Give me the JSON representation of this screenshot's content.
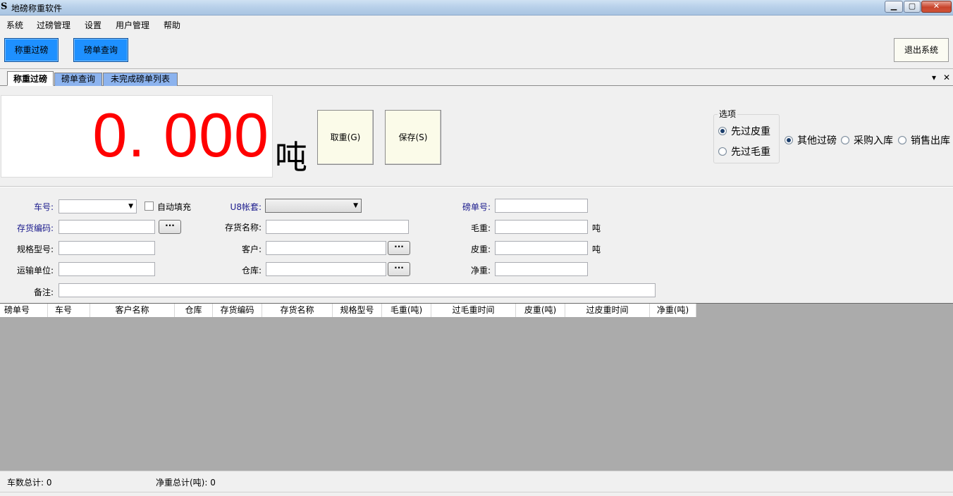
{
  "window": {
    "title": "地磅称重软件",
    "icon": "S"
  },
  "menu": [
    "系统",
    "过磅管理",
    "设置",
    "用户管理",
    "帮助"
  ],
  "toolbar": {
    "weigh_btn": "称重过磅",
    "query_btn": "磅单查询",
    "exit_btn": "退出系统"
  },
  "tabs": [
    {
      "label": "称重过磅",
      "active": true
    },
    {
      "label": "磅单查询",
      "active": false
    },
    {
      "label": "未完成磅单列表",
      "active": false
    }
  ],
  "tab_controls": {
    "dropdown": "▾",
    "close": "✕"
  },
  "scale": {
    "reading": "0. 000",
    "unit": "吨",
    "reading_color": "#ff0000"
  },
  "actions": {
    "take_weight": "取重(G)",
    "save": "保存(S)"
  },
  "options": {
    "group_title": "选项",
    "order": [
      {
        "label": "先过皮重",
        "checked": true
      },
      {
        "label": "先过毛重",
        "checked": false
      }
    ],
    "types": [
      {
        "label": "其他过磅",
        "checked": true
      },
      {
        "label": "采购入库",
        "checked": false
      },
      {
        "label": "销售出库",
        "checked": false
      }
    ]
  },
  "form": {
    "plate_label": "车号:",
    "auto_fill_label": "自动填充",
    "u8_label": "U8帐套:",
    "ticket_no_label": "磅单号:",
    "inv_code_label": "存货编码:",
    "inv_name_label": "存货名称:",
    "gross_label": "毛重:",
    "spec_label": "规格型号:",
    "customer_label": "客户:",
    "tare_label": "皮重:",
    "carrier_label": "运输单位:",
    "warehouse_label": "仓库:",
    "net_label": "净重:",
    "remark_label": "备注:",
    "unit": "吨",
    "ellipsis": "···"
  },
  "table": {
    "columns": [
      "磅单号",
      "车号",
      "客户名称",
      "仓库",
      "存货编码",
      "存货名称",
      "规格型号",
      "毛重(吨)",
      "过毛重时间",
      "皮重(吨)",
      "过皮重时间",
      "净重(吨)"
    ]
  },
  "status": {
    "vehicle_total": "车数总计: 0",
    "net_total": "净重总计(吨): 0"
  },
  "colors": {
    "toolbar_button": "#1e90ff",
    "tab_inactive": "#8cb3ee",
    "grid_background": "#ababab",
    "label_blue": "#1a1a8c"
  }
}
